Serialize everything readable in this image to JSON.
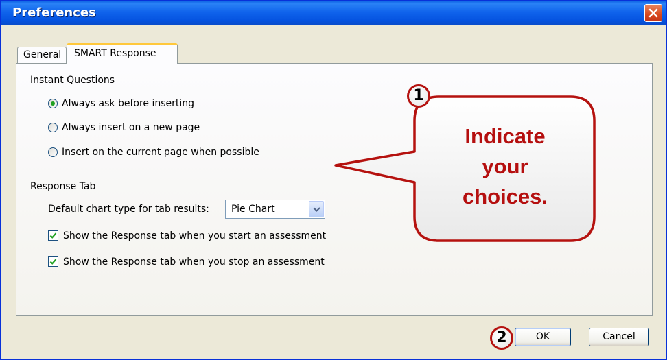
{
  "window": {
    "title": "Preferences"
  },
  "tabs": [
    {
      "label": "General",
      "selected": false
    },
    {
      "label": "SMART Response",
      "selected": true
    }
  ],
  "instant_questions": {
    "title": "Instant Questions",
    "options": [
      {
        "label": "Always ask before inserting",
        "selected": true
      },
      {
        "label": "Always insert on a new page",
        "selected": false
      },
      {
        "label": "Insert on the current page when possible",
        "selected": false
      }
    ]
  },
  "response_tab": {
    "title": "Response Tab",
    "chart_type_label": "Default chart type for tab results:",
    "chart_type_value": "Pie Chart",
    "checkboxes": [
      {
        "label": "Show the Response tab when you start an assessment",
        "checked": true
      },
      {
        "label": "Show the Response tab when you stop an assessment",
        "checked": true
      }
    ]
  },
  "buttons": {
    "ok": "OK",
    "cancel": "Cancel"
  },
  "annotations": {
    "step1": "1",
    "step2": "2",
    "callout_lines": [
      "Indicate",
      "your",
      "choices."
    ]
  },
  "colors": {
    "titlebar": "#0A5FE0",
    "callout_border": "#B5120F",
    "callout_text": "#B50F0F",
    "check_green": "#21A121"
  },
  "icons": {
    "close": "close-icon",
    "dropdown": "chevron-down-icon",
    "check": "checkmark-icon"
  }
}
